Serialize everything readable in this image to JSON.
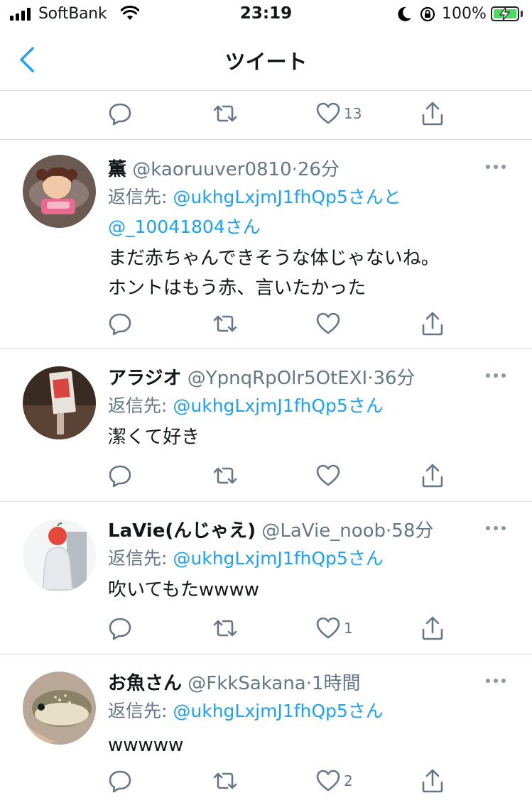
{
  "status_bar": {
    "carrier": "SoftBank",
    "time": "23:19",
    "battery": "100%"
  },
  "nav": {
    "title": "ツイート"
  },
  "top_actions": {
    "like_count": "13"
  },
  "tweets": [
    {
      "name": "薫",
      "handle": "@kaoruuver0810",
      "time": "26分",
      "reply_prefix": "返信先: ",
      "reply_to_1": "@ukhgLxjmJ1fhQp5さんと",
      "reply_to_2": "@_10041804さん",
      "body_1": "まだ赤ちゃんできそうな体じゃないね。",
      "body_2": "ホントはもう赤、言いたかった",
      "like_count": ""
    },
    {
      "name": "アラジオ",
      "handle": "@YpnqRpOlr5OtEXI",
      "time": "36分",
      "reply_prefix": "返信先: ",
      "reply_to_1": "@ukhgLxjmJ1fhQp5さん",
      "body_1": "潔くて好き",
      "like_count": ""
    },
    {
      "name": "LaVie(んじゃえ)",
      "handle": "@LaVie_noob",
      "time": "58分",
      "reply_prefix": "返信先: ",
      "reply_to_1": "@ukhgLxjmJ1fhQp5さん",
      "body_1": "吹いてもたwwww",
      "like_count": "1"
    },
    {
      "name": "お魚さん",
      "handle": "@FkkSakana",
      "time": "1時間",
      "reply_prefix": "返信先: ",
      "reply_to_1": "@ukhgLxjmJ1fhQp5さん",
      "body_1": "wwwww",
      "like_count": "2"
    }
  ],
  "icons": {
    "reply": "speech-bubble",
    "retweet": "retweet-arrows",
    "like": "heart-outline",
    "share": "share-arrow-up",
    "more": "ellipsis-horizontal",
    "back": "chevron-left"
  },
  "colors": {
    "accent": "#1da1f2",
    "secondary_text": "#657786",
    "icon": "#657786",
    "divider": "#d8dde1"
  }
}
